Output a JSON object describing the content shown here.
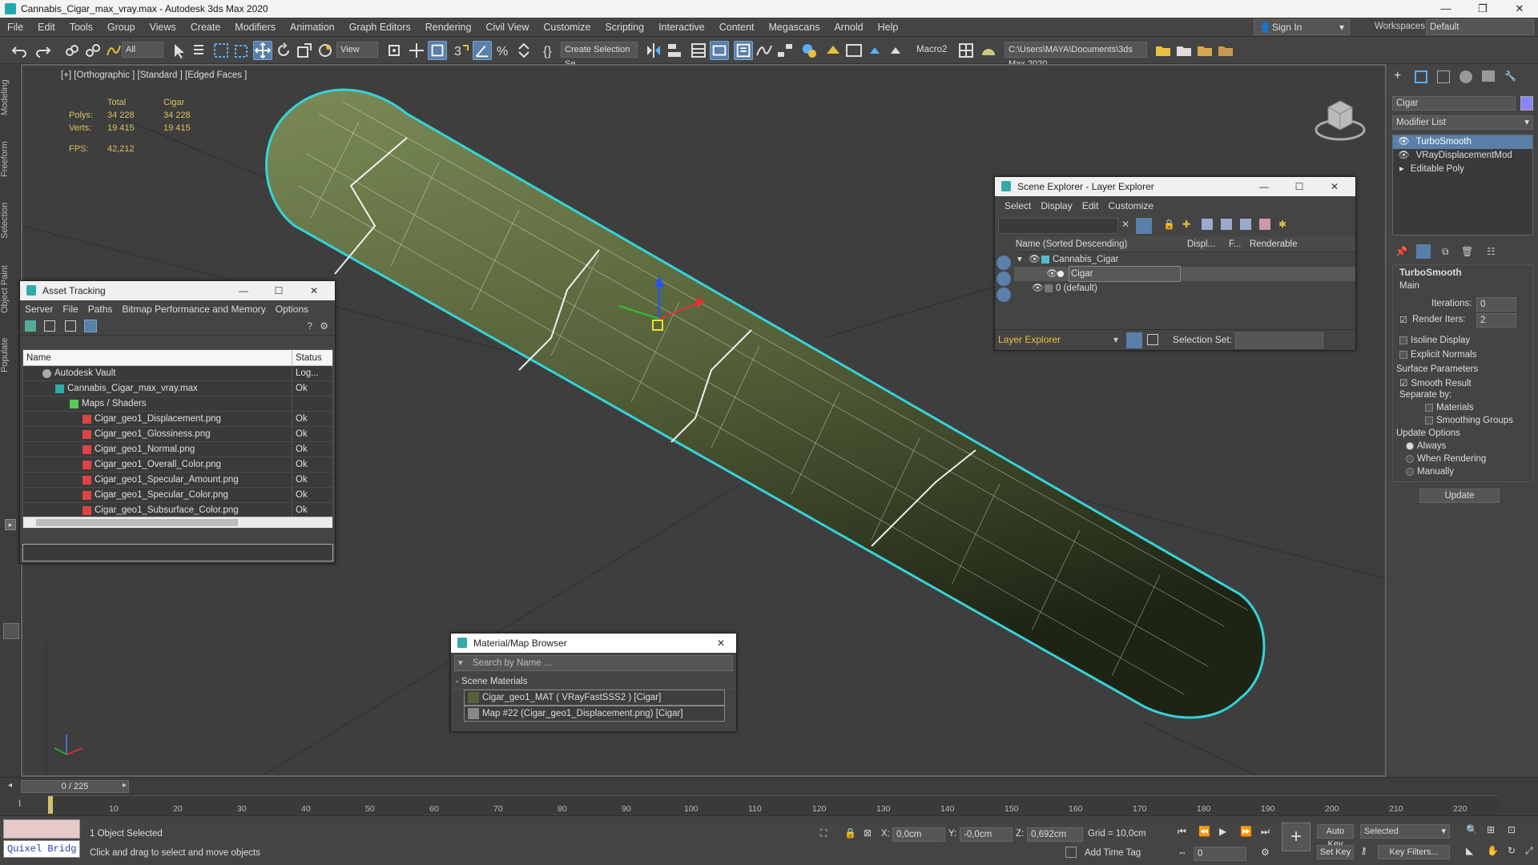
{
  "window": {
    "title": "Cannabis_Cigar_max_vray.max - Autodesk 3ds Max 2020",
    "buttons": [
      "—",
      "❐",
      "✕"
    ]
  },
  "menubar": {
    "items": [
      "File",
      "Edit",
      "Tools",
      "Group",
      "Views",
      "Create",
      "Modifiers",
      "Animation",
      "Graph Editors",
      "Rendering",
      "Civil View",
      "Customize",
      "Scripting",
      "Interactive",
      "Content",
      "Megascans",
      "Arnold",
      "Help"
    ],
    "sign_in": "Sign In",
    "workspaces_label": "Workspaces:",
    "workspace_value": "Default"
  },
  "toolbar": {
    "selection_filter": "All",
    "reference_coord": "View",
    "selection_set": "Create Selection Se",
    "macro": "Macro2",
    "project_path": "C:\\Users\\MAYA\\Documents\\3ds Max 2020"
  },
  "left_tabs": [
    "Modeling",
    "Freeform",
    "Selection",
    "Object Paint",
    "Populate"
  ],
  "viewport": {
    "label": "[+] [Orthographic ] [Standard ] [Edged Faces ]",
    "stats": {
      "col_total": "Total",
      "col_object": "Cigar",
      "polys_label": "Polys:",
      "polys_total": "34 228",
      "polys_object": "34 228",
      "verts_label": "Verts:",
      "verts_total": "19 415",
      "verts_object": "19 415",
      "fps_label": "FPS:",
      "fps_value": "42,212"
    }
  },
  "asset_tracking": {
    "title": "Asset Tracking",
    "menu": [
      "Server",
      "File",
      "Paths",
      "Bitmap Performance and Memory",
      "Options"
    ],
    "col_name": "Name",
    "col_status": "Status",
    "rows": [
      {
        "name": "Autodesk Vault",
        "status": "Log..."
      },
      {
        "name": "Cannabis_Cigar_max_vray.max",
        "status": "Ok"
      },
      {
        "name": "Maps / Shaders",
        "status": ""
      },
      {
        "name": "Cigar_geo1_Displacement.png",
        "status": "Ok"
      },
      {
        "name": "Cigar_geo1_Glossiness.png",
        "status": "Ok"
      },
      {
        "name": "Cigar_geo1_Normal.png",
        "status": "Ok"
      },
      {
        "name": "Cigar_geo1_Overall_Color.png",
        "status": "Ok"
      },
      {
        "name": "Cigar_geo1_Specular_Amount.png",
        "status": "Ok"
      },
      {
        "name": "Cigar_geo1_Specular_Color.png",
        "status": "Ok"
      },
      {
        "name": "Cigar_geo1_Subsurface_Color.png",
        "status": "Ok"
      }
    ]
  },
  "material_browser": {
    "title": "Material/Map Browser",
    "search_placeholder": "Search by Name ...",
    "section": "- Scene Materials",
    "items": [
      "Cigar_geo1_MAT  ( VRayFastSSS2 )  [Cigar]",
      "Map #22 (Cigar_geo1_Displacement.png) [Cigar]"
    ]
  },
  "scene_explorer": {
    "title": "Scene Explorer - Layer Explorer",
    "menu": [
      "Select",
      "Display",
      "Edit",
      "Customize"
    ],
    "col_name": "Name (Sorted Descending)",
    "col_display": "Displ...",
    "col_f": "F...",
    "col_renderable": "Renderable",
    "rows": [
      "Cannabis_Cigar",
      "Cigar",
      "0 (default)"
    ],
    "explorer_mode": "Layer Explorer",
    "selection_set_label": "Selection Set:"
  },
  "command_panel": {
    "object_name": "Cigar",
    "modifier_list": "Modifier List",
    "stack": [
      "TurboSmooth",
      "VRayDisplacementMod",
      "Editable Poly"
    ],
    "rollout_title": "TurboSmooth",
    "main_label": "Main",
    "iterations_label": "Iterations:",
    "iterations_value": "0",
    "render_iters_label": "Render Iters:",
    "render_iters_value": "2",
    "isoline_label": "Isoline Display",
    "explicit_normals_label": "Explicit Normals",
    "surface_params_label": "Surface Parameters",
    "smooth_result_label": "Smooth Result",
    "separate_by_label": "Separate by:",
    "materials_label": "Materials",
    "smoothing_groups_label": "Smoothing Groups",
    "update_options_label": "Update Options",
    "always_label": "Always",
    "when_rendering_label": "When Rendering",
    "manually_label": "Manually",
    "update_button": "Update"
  },
  "timeline": {
    "frame_display": "0 / 225",
    "ticks": [
      "0",
      "10",
      "20",
      "30",
      "40",
      "50",
      "60",
      "70",
      "80",
      "90",
      "100",
      "110",
      "120",
      "130",
      "140",
      "150",
      "160",
      "170",
      "180",
      "190",
      "200",
      "210",
      "220"
    ]
  },
  "statusbar": {
    "quixel_button": "Quixel Bridg",
    "selection_status": "1 Object Selected",
    "prompt": "Click and drag to select and move objects",
    "x_label": "X:",
    "x_value": "0,0cm",
    "y_label": "Y:",
    "y_value": "-0,0cm",
    "z_label": "Z:",
    "z_value": "0,692cm",
    "grid": "Grid = 10,0cm",
    "add_time_tag": "Add Time Tag",
    "auto_key": "Auto Key",
    "set_key": "Set Key",
    "key_mode": "Selected",
    "frame_field": "0",
    "key_filters": "Key Filters..."
  },
  "colors": {
    "selection_outline": "#35d3d9",
    "cigar_green": "#56623a",
    "wire": "#ffffff",
    "panel_bg": "#444444",
    "highlight": "#5a7fa8"
  }
}
